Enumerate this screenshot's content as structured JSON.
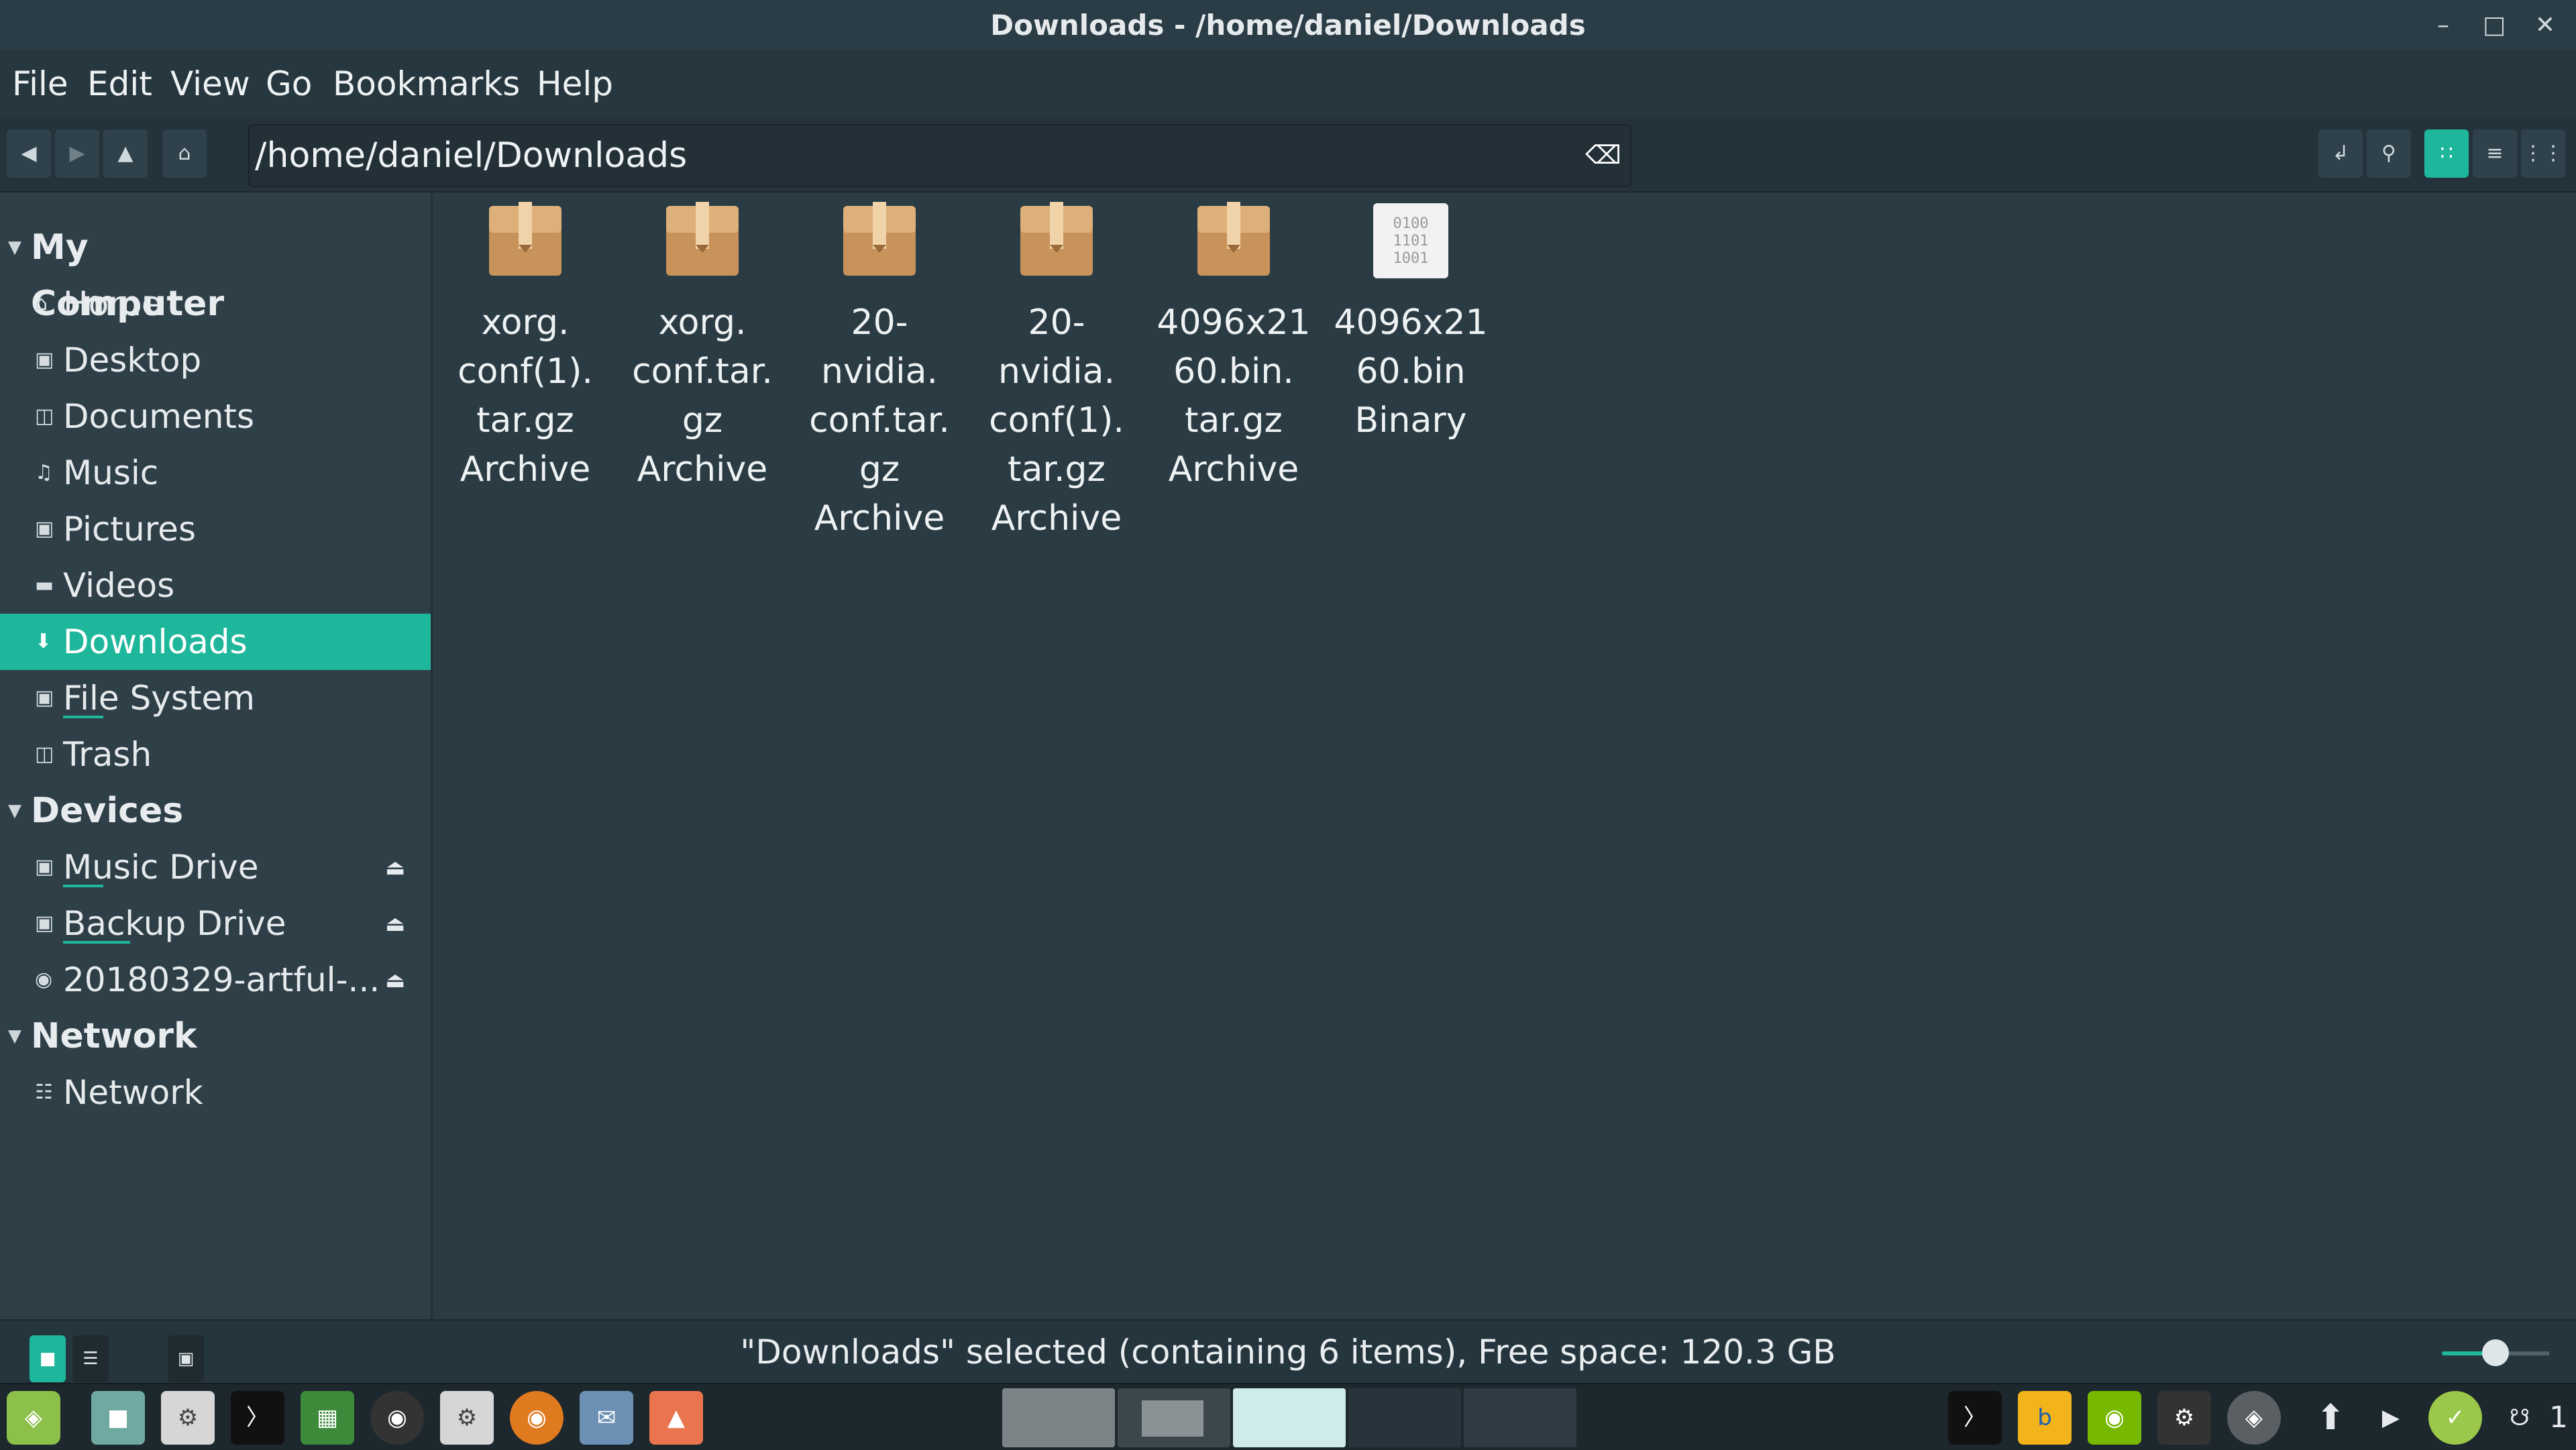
{
  "window": {
    "title": "Downloads - /home/daniel/Downloads",
    "minimize_icon": "minimize-icon",
    "maximize_icon": "maximize-icon",
    "close_icon": "close-icon"
  },
  "menubar": {
    "items": [
      "File",
      "Edit",
      "View",
      "Go",
      "Bookmarks",
      "Help"
    ]
  },
  "toolbar": {
    "path": "/home/daniel/Downloads"
  },
  "sidebar": {
    "sections": [
      {
        "title": "My Computer",
        "items": [
          "Home",
          "Desktop",
          "Documents",
          "Music",
          "Pictures",
          "Videos",
          "Downloads",
          "File System",
          "Trash"
        ]
      },
      {
        "title": "Devices",
        "items": [
          "Music Drive",
          "Backup Drive",
          "20180329-artful-..."
        ]
      },
      {
        "title": "Network",
        "items": [
          "Network"
        ]
      }
    ],
    "selected": "Downloads"
  },
  "files": [
    {
      "name": "xorg.\nconf(1).\ntar.gz",
      "type": "Archive",
      "kind": "archive"
    },
    {
      "name": "xorg.\nconf.tar.\ngz",
      "type": "Archive",
      "kind": "archive"
    },
    {
      "name": "20-\nnvidia.\nconf.tar.\ngz",
      "type": "Archive",
      "kind": "archive"
    },
    {
      "name": "20-\nnvidia.\nconf(1).\ntar.gz",
      "type": "Archive",
      "kind": "archive"
    },
    {
      "name": "4096x21\n60.bin.\ntar.gz",
      "type": "Archive",
      "kind": "archive"
    },
    {
      "name": "4096x21\n60.bin",
      "type": "Binary",
      "kind": "binary",
      "glyph": "0100\n1101\n1001"
    }
  ],
  "status": {
    "text": "\"Downloads\" selected (containing 6 items), Free space: 120.3 GB"
  },
  "taskbar": {
    "notification_count": "1"
  },
  "colors": {
    "accent": "#1fb79b",
    "background": "#2b3b44"
  }
}
